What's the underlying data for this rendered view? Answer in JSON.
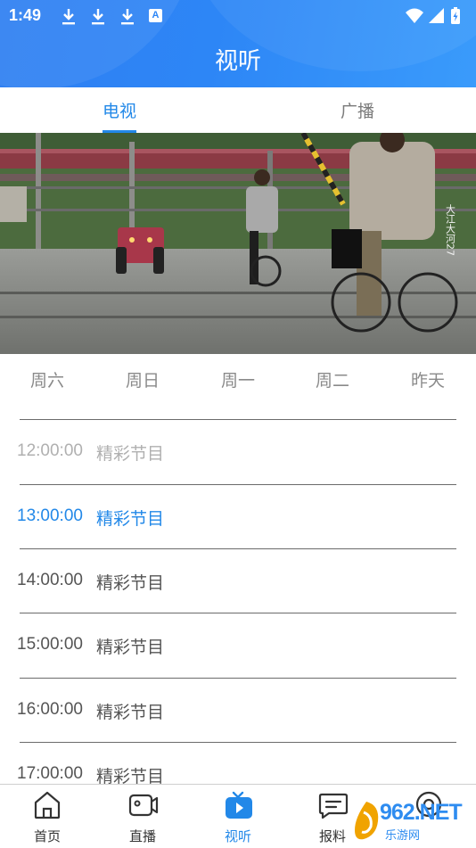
{
  "statusbar": {
    "time": "1:49",
    "icons": [
      "download-icon",
      "download-icon",
      "download-icon",
      "a-badge-icon"
    ],
    "badge_letter": "A",
    "right_icons": [
      "wifi-icon",
      "signal-icon",
      "battery-icon"
    ]
  },
  "header": {
    "title": "视听"
  },
  "tabs": [
    {
      "label": "电视",
      "active": true
    },
    {
      "label": "广播",
      "active": false
    }
  ],
  "video": {
    "overlay_text": "大江大河27"
  },
  "days": [
    "周六",
    "周日",
    "周一",
    "周二",
    "昨天"
  ],
  "schedule": [
    {
      "time": "12:00:00",
      "name": "精彩节目",
      "state": "past"
    },
    {
      "time": "13:00:00",
      "name": "精彩节目",
      "state": "live"
    },
    {
      "time": "14:00:00",
      "name": "精彩节目",
      "state": "upcoming"
    },
    {
      "time": "15:00:00",
      "name": "精彩节目",
      "state": "upcoming"
    },
    {
      "time": "16:00:00",
      "name": "精彩节目",
      "state": "upcoming"
    },
    {
      "time": "17:00:00",
      "name": "精彩节目",
      "state": "upcoming"
    }
  ],
  "nav": [
    {
      "label": "首页",
      "icon": "home-icon",
      "active": false
    },
    {
      "label": "直播",
      "icon": "camera-icon",
      "active": false
    },
    {
      "label": "视听",
      "icon": "tv-icon",
      "active": true
    },
    {
      "label": "报料",
      "icon": "message-icon",
      "active": false
    },
    {
      "label": "",
      "icon": "profile-icon",
      "active": false
    }
  ],
  "watermark": {
    "text": "962.NET",
    "sub": "乐游网"
  },
  "colors": {
    "accent": "#2288e8",
    "header": "#2d86f6"
  }
}
